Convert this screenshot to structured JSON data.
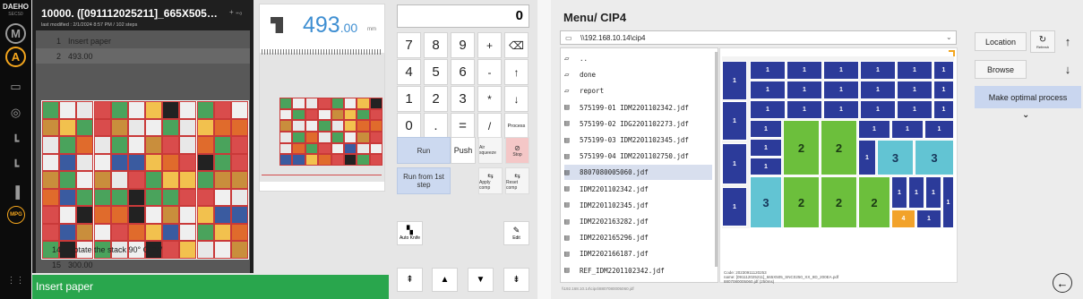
{
  "rail": {
    "brand": "DAEHO",
    "model": "SECS0",
    "icons": [
      "M",
      "A",
      "paper-icon",
      "knife-icon",
      "pusher-x-icon",
      "pusher-x-icon",
      "pusher-forward-icon",
      "MPG",
      "grid-icon"
    ]
  },
  "job": {
    "title": "10000. ([091112025211]_665X505_SN...",
    "subtitle": "last modified : 2/1/2024 8:57 PM / 102 steps",
    "steps": [
      {
        "n": "1",
        "t": "Insert paper"
      },
      {
        "n": "2",
        "t": "493.00"
      }
    ],
    "steps_bottom": [
      {
        "n": "14",
        "t": "Rotate the stack 90° CCW"
      },
      {
        "n": "15",
        "t": "300.00"
      }
    ]
  },
  "status": "Insert paper",
  "preview": {
    "value_int": "493",
    "value_dec": ".00",
    "unit": "mm"
  },
  "pad": {
    "display": "0",
    "keys": [
      "7",
      "8",
      "9",
      "+",
      "⌫",
      "4",
      "5",
      "6",
      "-",
      "↑",
      "1",
      "2",
      "3",
      "*",
      "↓",
      "0",
      ".",
      "=",
      "/",
      "Process"
    ],
    "run": "Run",
    "push": "Push",
    "air": "Air squeeze",
    "stop": "Stop",
    "run_first": "Run from 1st step",
    "apply_comp": "Apply comp",
    "reset_comp": "Reset comp",
    "auto_knife": "Auto Knife",
    "edit": "Edit"
  },
  "cip": {
    "title": "Menu/ CIP4",
    "path": "\\\\192.168.10.14\\cip4",
    "files": [
      {
        "name": "..",
        "type": "folder"
      },
      {
        "name": "done",
        "type": "folder"
      },
      {
        "name": "report",
        "type": "folder"
      },
      {
        "name": "575199-01 IDM2201102342.jdf",
        "type": "file"
      },
      {
        "name": "575199-02 IDG2201102273.jdf",
        "type": "file"
      },
      {
        "name": "575199-03 IDM2201102345.jdf",
        "type": "file"
      },
      {
        "name": "575199-04 IDM2201102750.jdf",
        "type": "file"
      },
      {
        "name": "8807080005060.jdf",
        "type": "file",
        "selected": true
      },
      {
        "name": "IDM2201102342.jdf",
        "type": "file"
      },
      {
        "name": "IDM2201102345.jdf",
        "type": "file"
      },
      {
        "name": "IDM2202163282.jdf",
        "type": "file"
      },
      {
        "name": "IDM2202165296.jdf",
        "type": "file"
      },
      {
        "name": "IDM2202166187.jdf",
        "type": "file"
      },
      {
        "name": "REF_IDM2201102342.jdf",
        "type": "file"
      }
    ],
    "footer_path": "\\\\192.168.10.14\\cip4\\8807080005060.jdf",
    "meta": [
      "Code: 20230911120253",
      "name: [091112025211]_665X505_SNC0250_XX_8D_200EA.pdf",
      "8807080005060.jdf (250ms)"
    ],
    "buttons": {
      "location": "Location",
      "refresh": "Refresh",
      "browse": "Browse",
      "optimal": "Make optimal process"
    },
    "colors": {
      "blue": "#2c3b9a",
      "green": "#6cbf3c",
      "cyan": "#62c4d3",
      "orange": "#f2a22a"
    }
  }
}
